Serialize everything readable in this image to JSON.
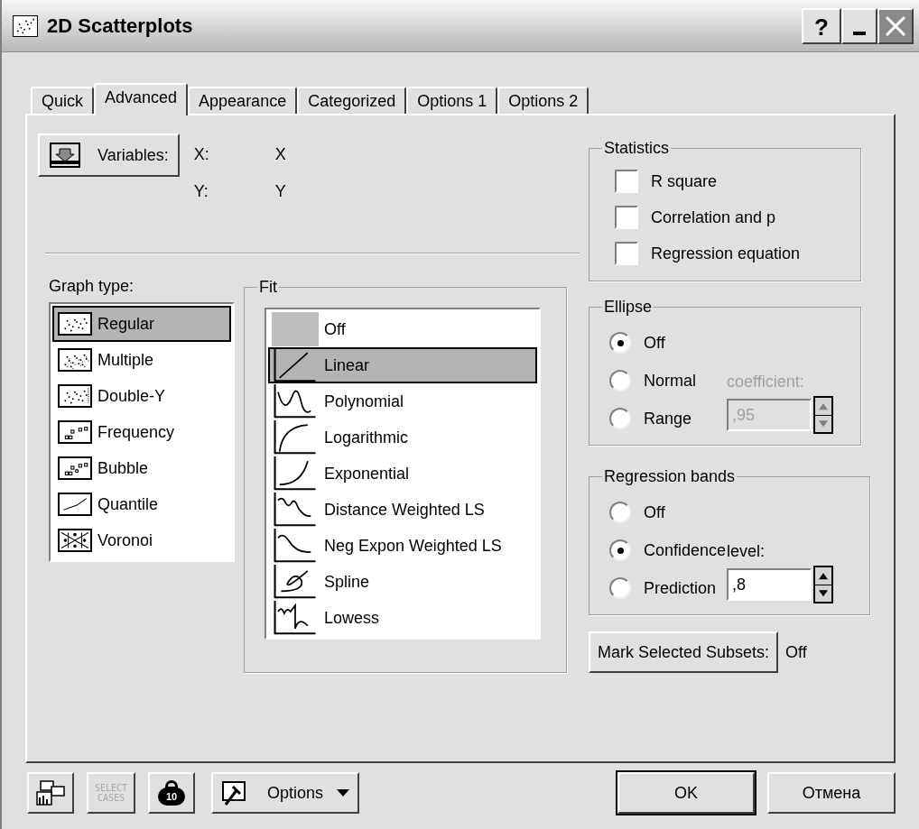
{
  "window": {
    "title": "2D Scatterplots",
    "controls": [
      {
        "kind": "help",
        "label": "?"
      },
      {
        "kind": "minimize"
      },
      {
        "kind": "close"
      }
    ]
  },
  "tabs": [
    {
      "label": "Quick",
      "selected": false
    },
    {
      "label": "Advanced",
      "selected": true
    },
    {
      "label": "Appearance",
      "selected": false
    },
    {
      "label": "Categorized",
      "selected": false
    },
    {
      "label": "Options 1",
      "selected": false
    },
    {
      "label": "Options 2",
      "selected": false
    }
  ],
  "variables": {
    "button": "Variables:",
    "rows": [
      {
        "label": "X:",
        "value": "X"
      },
      {
        "label": "Y:",
        "value": "Y"
      }
    ]
  },
  "graph_type": {
    "label": "Graph type:",
    "items": [
      {
        "label": "Regular",
        "kind": "regular",
        "selected": true
      },
      {
        "label": "Multiple",
        "kind": "multiple",
        "selected": false
      },
      {
        "label": "Double-Y",
        "kind": "double-y",
        "selected": false
      },
      {
        "label": "Frequency",
        "kind": "frequency",
        "selected": false
      },
      {
        "label": "Bubble",
        "kind": "bubble",
        "selected": false
      },
      {
        "label": "Quantile",
        "kind": "quantile",
        "selected": false
      },
      {
        "label": "Voronoi",
        "kind": "voronoi",
        "selected": false
      }
    ]
  },
  "fit": {
    "label": "Fit",
    "items": [
      {
        "label": "Off",
        "kind": "off",
        "selected": false
      },
      {
        "label": "Linear",
        "kind": "linear",
        "selected": true
      },
      {
        "label": "Polynomial",
        "kind": "polynomial",
        "selected": false
      },
      {
        "label": "Logarithmic",
        "kind": "logarithmic",
        "selected": false
      },
      {
        "label": "Exponential",
        "kind": "exponential",
        "selected": false
      },
      {
        "label": "Distance Weighted LS",
        "kind": "dwls",
        "selected": false
      },
      {
        "label": "Neg Expon Weighted LS",
        "kind": "negexp",
        "selected": false
      },
      {
        "label": "Spline",
        "kind": "spline",
        "selected": false
      },
      {
        "label": "Lowess",
        "kind": "lowess",
        "selected": false
      }
    ]
  },
  "statistics": {
    "label": "Statistics",
    "items": [
      {
        "label": "R square",
        "checked": false
      },
      {
        "label": "Correlation and p",
        "checked": false
      },
      {
        "label": "Regression equation",
        "checked": false
      }
    ]
  },
  "ellipse": {
    "label": "Ellipse",
    "options": [
      {
        "label": "Off",
        "selected": true
      },
      {
        "label": "Normal",
        "selected": false
      },
      {
        "label": "Range",
        "selected": false
      }
    ],
    "field_label": "coefficient:",
    "value": ",95",
    "disabled": true
  },
  "regression_bands": {
    "label": "Regression bands",
    "options": [
      {
        "label": "Off",
        "selected": false
      },
      {
        "label": "Confidence",
        "selected": true
      },
      {
        "label": "Prediction",
        "selected": false
      }
    ],
    "field_label": "level:",
    "value": ",8",
    "disabled": false
  },
  "mark_subsets": {
    "button": "Mark Selected Subsets:",
    "value": "Off"
  },
  "footer": {
    "select_cases": {
      "label": "SELECT CASES",
      "disabled": true
    },
    "weight": {
      "label": "10"
    },
    "options": "Options",
    "ok": "OK",
    "cancel": "Отмена"
  }
}
